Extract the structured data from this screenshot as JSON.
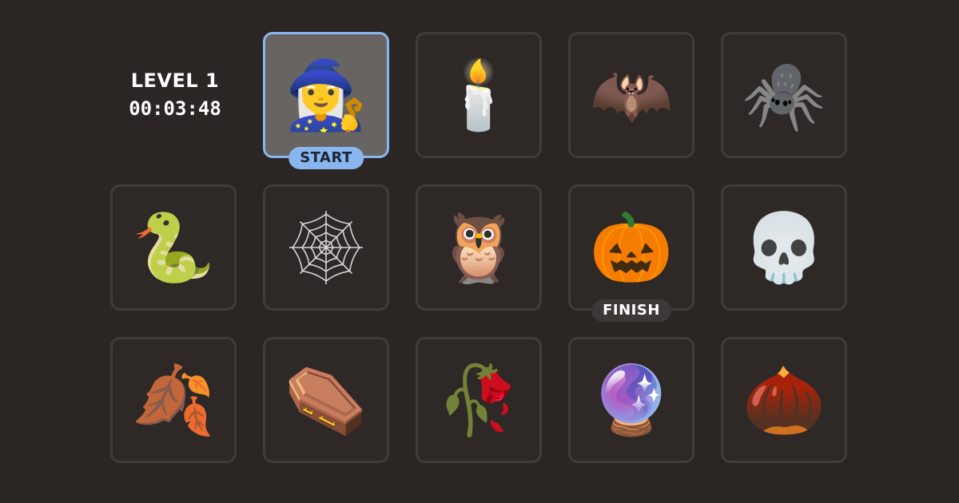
{
  "hud": {
    "level": "LEVEL 1",
    "timer": "00:03:48"
  },
  "colors": {
    "background": "#2b2523",
    "tile_border": "#423b39",
    "selected_tile": "#676462",
    "selected_border": "#8ab6ef",
    "start_badge": "#8ab6ef",
    "finish_badge": "#3d3836"
  },
  "badges": {
    "start": "START",
    "finish": "FINISH"
  },
  "board": {
    "rows": [
      [
        null,
        {
          "icon": "mage-icon",
          "glyph": "🧙‍♀️",
          "selected": true,
          "badge": "start"
        },
        {
          "icon": "candle-icon",
          "glyph": "🕯️"
        },
        {
          "icon": "bat-icon",
          "glyph": "🦇"
        },
        {
          "icon": "spider-icon",
          "glyph": "🕷️"
        }
      ],
      [
        {
          "icon": "snake-icon",
          "glyph": "🐍"
        },
        {
          "icon": "spider-web-icon",
          "glyph": "🕸️"
        },
        {
          "icon": "owl-icon",
          "glyph": "🦉"
        },
        {
          "icon": "jack-o-lantern-icon",
          "glyph": "🎃",
          "badge": "finish"
        },
        {
          "icon": "skull-icon",
          "glyph": "💀"
        }
      ],
      [
        {
          "icon": "fallen-leaf-icon",
          "glyph": "🍂"
        },
        {
          "icon": "coffin-icon",
          "glyph": "⚰️"
        },
        {
          "icon": "wilted-flower-icon",
          "glyph": "🥀"
        },
        {
          "icon": "crystal-ball-icon",
          "glyph": "🔮"
        },
        {
          "icon": "chestnut-icon",
          "glyph": "🌰"
        }
      ]
    ]
  }
}
